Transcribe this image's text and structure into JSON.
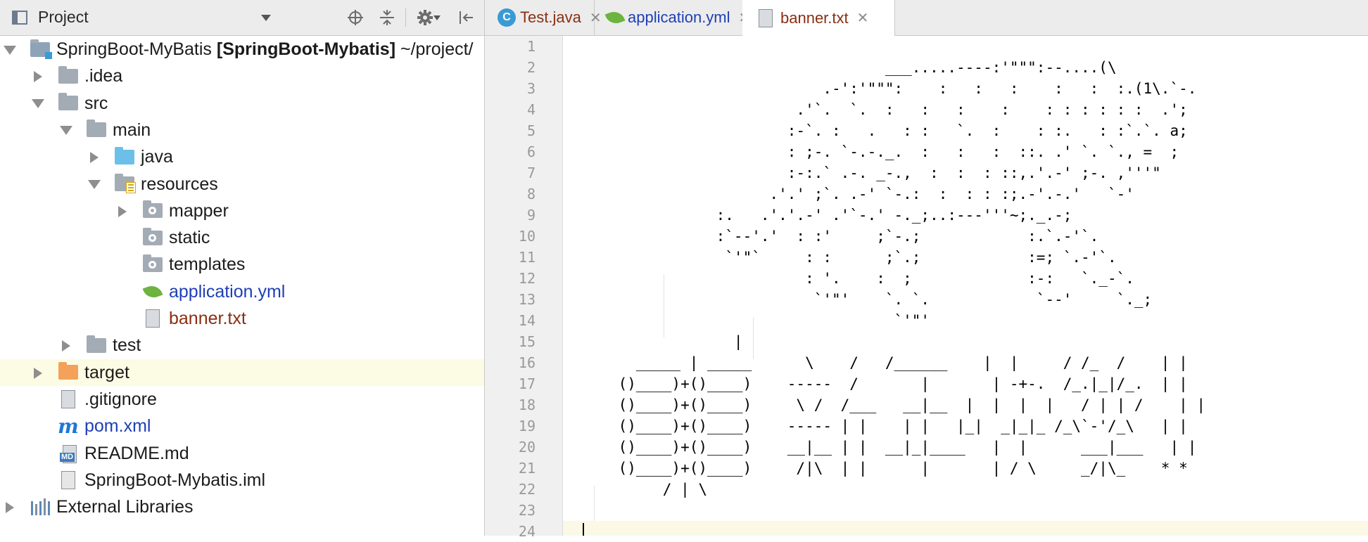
{
  "project_panel": {
    "title": "Project",
    "tree": [
      {
        "label": "SpringBoot-MyBatis",
        "module_label": " [SpringBoot-Mybatis]",
        "path": "  ~/project/",
        "indent": 0,
        "arrow": "open",
        "icon": "module-folder-icon",
        "color": "#1b1b1b"
      },
      {
        "label": ".idea",
        "indent": 1,
        "arrow": "closed",
        "icon": "folder-icon",
        "color": "#1b1b1b"
      },
      {
        "label": "src",
        "indent": 1,
        "arrow": "open",
        "icon": "folder-icon",
        "color": "#1b1b1b"
      },
      {
        "label": "main",
        "indent": 2,
        "arrow": "open",
        "icon": "folder-icon",
        "color": "#1b1b1b"
      },
      {
        "label": "java",
        "indent": 3,
        "arrow": "closed",
        "icon": "source-folder-icon",
        "color": "#1b1b1b"
      },
      {
        "label": "resources",
        "indent": 3,
        "arrow": "open",
        "icon": "resources-folder-icon",
        "color": "#1b1b1b"
      },
      {
        "label": "mapper",
        "indent": 4,
        "arrow": "closed",
        "icon": "package-folder-icon",
        "color": "#1b1b1b"
      },
      {
        "label": "static",
        "indent": 4,
        "arrow": "none",
        "icon": "package-folder-icon",
        "color": "#1b1b1b"
      },
      {
        "label": "templates",
        "indent": 4,
        "arrow": "none",
        "icon": "package-folder-icon",
        "color": "#1b1b1b"
      },
      {
        "label": "application.yml",
        "indent": 4,
        "arrow": "none",
        "icon": "spring-config-icon",
        "color": "#1f3fb5"
      },
      {
        "label": "banner.txt",
        "indent": 4,
        "arrow": "none",
        "icon": "text-file-icon",
        "color": "#8a2f12"
      },
      {
        "label": "test",
        "indent": 2,
        "arrow": "closed",
        "icon": "folder-icon",
        "color": "#1b1b1b"
      },
      {
        "label": "target",
        "indent": 1,
        "arrow": "closed",
        "icon": "excluded-folder-icon",
        "color": "#1b1b1b",
        "highlight": true
      },
      {
        "label": ".gitignore",
        "indent": 1,
        "arrow": "none",
        "icon": "text-file-icon",
        "color": "#1b1b1b"
      },
      {
        "label": "pom.xml",
        "indent": 1,
        "arrow": "none",
        "icon": "maven-icon",
        "color": "#1f3fb5"
      },
      {
        "label": "README.md",
        "indent": 1,
        "arrow": "none",
        "icon": "markdown-icon",
        "color": "#1b1b1b"
      },
      {
        "label": "SpringBoot-Mybatis.iml",
        "indent": 1,
        "arrow": "none",
        "icon": "iml-file-icon",
        "color": "#1b1b1b"
      },
      {
        "label": "External Libraries",
        "indent": 0,
        "arrow": "closed",
        "icon": "libraries-icon",
        "color": "#1b1b1b"
      }
    ]
  },
  "tabs": [
    {
      "label": "Test.java",
      "icon": "java-class-icon",
      "color": "#8a2f12",
      "active": false
    },
    {
      "label": "application.yml",
      "icon": "spring-config-icon",
      "color": "#1f3fb5",
      "active": false
    },
    {
      "label": "banner.txt",
      "icon": "text-file-icon",
      "color": "#8a2f12",
      "active": true
    }
  ],
  "editor": {
    "line_numbers": [
      "1",
      "2",
      "3",
      "4",
      "5",
      "6",
      "7",
      "8",
      "9",
      "10",
      "11",
      "12",
      "13",
      "14",
      "15",
      "16",
      "17",
      "18",
      "19",
      "20",
      "21",
      "22",
      "23",
      "24"
    ],
    "lines": [
      "",
      "                                  ___.....----:'\"\"\":--....(\\",
      "                           .-':'\"\"\":    :   :   :    :   :  :.(1\\.`-.",
      "                        .'`.  `.  :   :   :    :    : : : : : :  .';",
      "                       :-`. :   .   : :   `.  :    : :.   : :`.`. a;",
      "                       : ;-. `-.-._.  :   :   :  ::. .' `. `., =  ;",
      "                       :-:.` .-. _-.,  :  :  : ::,.'.-' ;-. ,'''\"",
      "                     .'.' ;`. .-' `-.:  :  : : :;.-'.-.'   `-'",
      "               :.   .'.'.-' .'`-.' -._;..:---'''~;._.-;",
      "               :`--'.'  : :'     ;`-.;            :.`.-'`.",
      "                `'\"`     : :      ;`.;            :=; `.-'`.",
      "                         : '.    :  ;             :-:   `._-`.",
      "                          `'\"'    `. `.            `--'     `._;",
      "                                   `'\"'",
      "                 |",
      "      _____ | _____      \\    /   /______    |  |     / /_  /    | |",
      "    ()____)+()____)    -----  /       |       | -+-.  /_.|_|/_.  | |",
      "    ()____)+()____)     \\ /  /___   __|__  |  |  |  |   / | | /    | |",
      "    ()____)+()____)    ----- | |    | |   |_|  _|_|_ /_\\`-'/_\\   | |",
      "    ()____)+()____)    __|__ | |  __|_|____   |  |      ___|___   | |",
      "    ()____)+()____)     /|\\  | |      |       | / \\     _/|\\_    * *",
      "         / | \\",
      "",
      ""
    ]
  }
}
